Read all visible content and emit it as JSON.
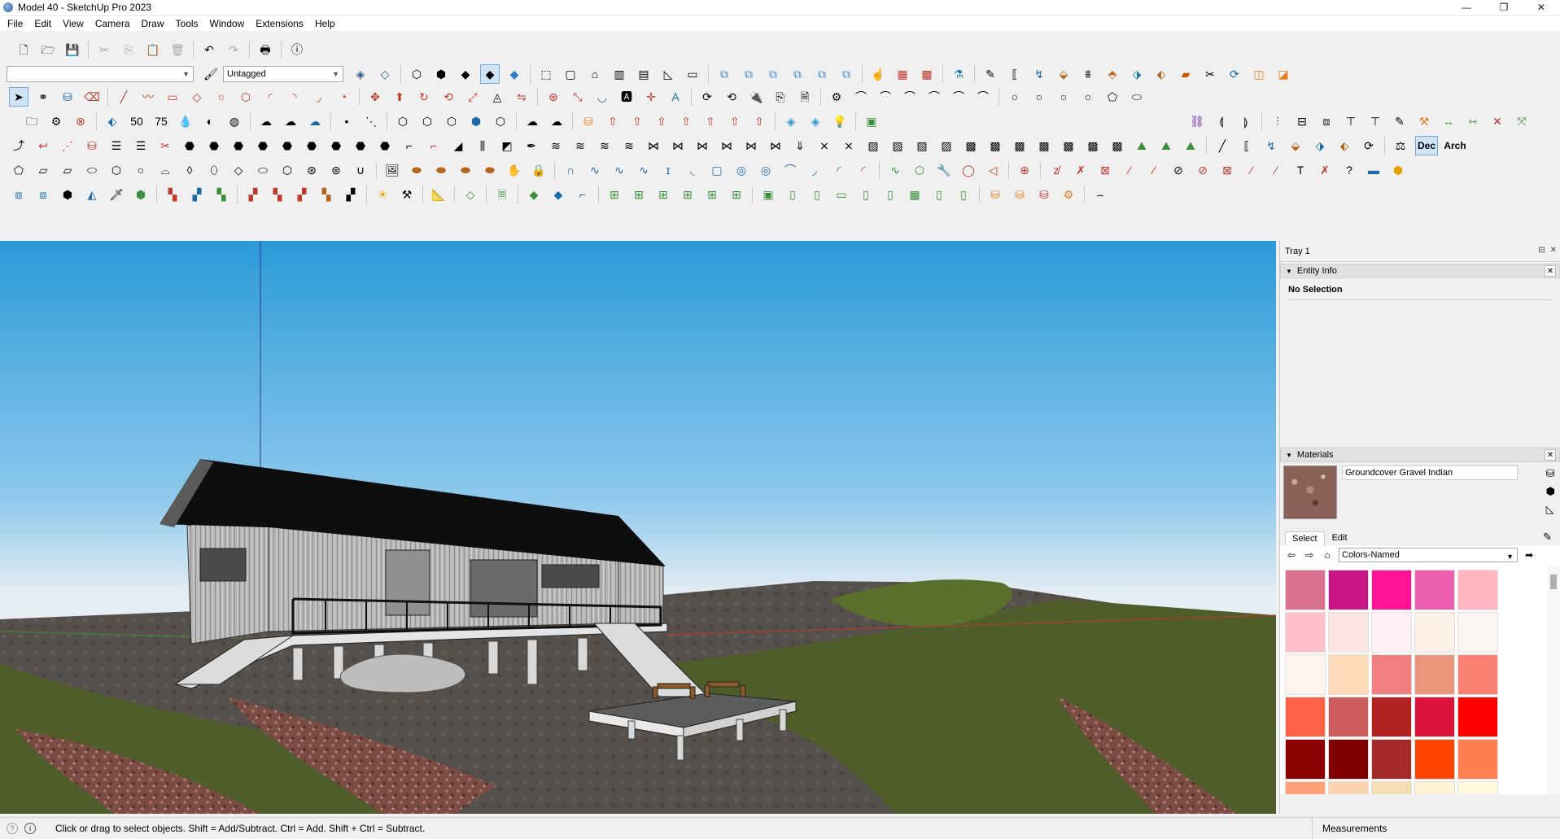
{
  "window": {
    "title": "Model 40 - SketchUp Pro 2023",
    "minimize": "—",
    "maximize": "❐",
    "close": "✕"
  },
  "menu": [
    "File",
    "Edit",
    "View",
    "Camera",
    "Draw",
    "Tools",
    "Window",
    "Extensions",
    "Help"
  ],
  "toolbar": {
    "layer_select_value": "",
    "tag_select_value": "Untagged",
    "dec_label": "Dec",
    "arch_label": "Arch",
    "num50_label": "50",
    "num75_label": "75"
  },
  "tray": {
    "title": "Tray 1",
    "entity_info": {
      "title": "Entity Info",
      "selection_text": "No Selection"
    },
    "materials": {
      "title": "Materials",
      "current_name": "Groundcover Gravel Indian",
      "tabs": [
        "Select",
        "Edit"
      ],
      "active_tab": "Select",
      "library": "Colors-Named",
      "swatches": [
        "#d9718f",
        "#c71585",
        "#ff1493",
        "#ec5fb0",
        "#ffb6c1",
        "#ffc0cb",
        "#fbe4e4",
        "#fff0f5",
        "#faf0e6",
        "#faf7f4",
        "#fff5ee",
        "#ffdab9",
        "#f08080",
        "#e9967a",
        "#fa8072",
        "#ff6347",
        "#cd5c5c",
        "#b22222",
        "#dc143c",
        "#ff0000",
        "#8b0000",
        "#800000",
        "#a52a2a",
        "#ff4500",
        "#ff7f50",
        "#ffa07a",
        "#fad2b0",
        "#f5deb3",
        "#fff3d6",
        "#fff8dc"
      ]
    }
  },
  "status": {
    "message": "Click or drag to select objects. Shift = Add/Subtract. Ctrl = Add. Shift + Ctrl = Subtract.",
    "measurements_label": "Measurements"
  },
  "colors": {
    "sky_top": "#2a9ad8",
    "sky_bottom": "#e6eef3",
    "ground_green": "#4f5d2a",
    "ground_dirt": "#7b4c43",
    "accent_select": "#cfe3f6"
  }
}
